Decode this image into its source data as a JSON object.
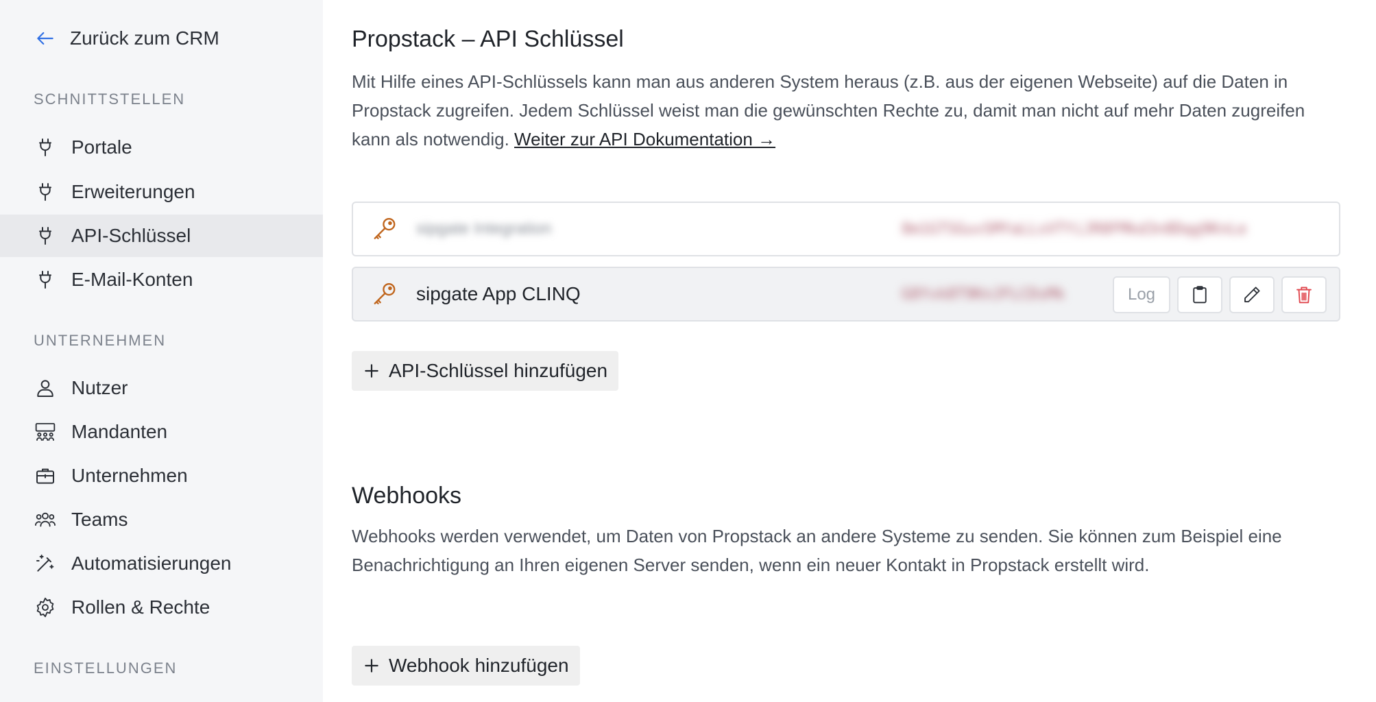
{
  "sidebar": {
    "back_label": "Zurück zum CRM",
    "sections": [
      {
        "title": "SCHNITTSTELLEN",
        "items": [
          {
            "label": "Portale",
            "icon": "plug-icon"
          },
          {
            "label": "Erweiterungen",
            "icon": "plug-icon"
          },
          {
            "label": "API-Schlüssel",
            "icon": "plug-icon",
            "active": true
          },
          {
            "label": "E-Mail-Konten",
            "icon": "plug-icon"
          }
        ]
      },
      {
        "title": "UNTERNEHMEN",
        "items": [
          {
            "label": "Nutzer",
            "icon": "user-icon"
          },
          {
            "label": "Mandanten",
            "icon": "users-group-icon"
          },
          {
            "label": "Unternehmen",
            "icon": "briefcase-icon"
          },
          {
            "label": "Teams",
            "icon": "team-icon"
          },
          {
            "label": "Automatisierungen",
            "icon": "magic-wand-icon"
          },
          {
            "label": "Rollen & Rechte",
            "icon": "gear-icon"
          }
        ]
      },
      {
        "title": "EINSTELLUNGEN",
        "items": []
      }
    ]
  },
  "api": {
    "title": "Propstack – API Schlüssel",
    "description": "Mit Hilfe eines API-Schlüssels kann man aus anderen System heraus (z.B. aus der eigenen Webseite) auf die Daten in Propstack zugreifen. Jedem Schlüssel weist man die gewünschten Rechte zu, damit man nicht auf mehr Daten zugreifen kann als notwendig. ",
    "doc_link": "Weiter zur API Dokumentation →",
    "keys": [
      {
        "name": "sipgate Integration",
        "token": "8m1GTSGuvSMYaLLsVTYiJR8FMkd3n8Dqg9KnLe",
        "blurred": true
      },
      {
        "name": "sipgate App CLINQ",
        "token": "G8Yvk8T9KnJFLCDsMk",
        "blurred": false
      }
    ],
    "log_label": "Log",
    "add_label": "API-Schlüssel hinzufügen"
  },
  "webhooks": {
    "title": "Webhooks",
    "description": "Webhooks werden verwendet, um Daten von Propstack an andere Systeme zu senden. Sie können zum Beispiel eine Benachrichtigung an Ihren eigenen Server senden, wenn ein neuer Kontakt in Propstack erstellt wird.",
    "add_label": "Webhook hinzufügen"
  },
  "colors": {
    "accent": "#2f6fe4",
    "key_icon": "#c0651c",
    "danger": "#e0454c"
  }
}
